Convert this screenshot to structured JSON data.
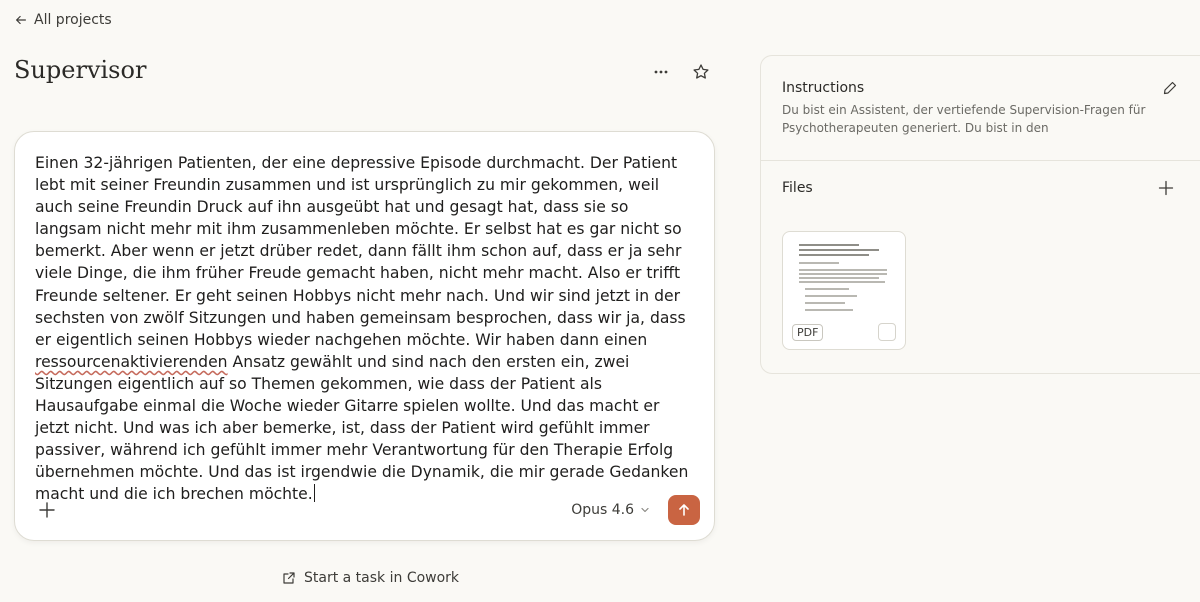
{
  "nav": {
    "back_label": "All projects"
  },
  "project": {
    "title": "Supervisor"
  },
  "composer": {
    "text_before": "Einen 32-jährigen Patienten, der eine depressive Episode durchmacht. Der Patient lebt mit seiner Freundin zusammen und ist ursprünglich zu mir gekommen, weil auch seine Freundin Druck auf ihn ausgeübt hat und gesagt hat, dass sie so langsam nicht mehr mit ihm zusammenleben möchte. Er selbst hat es gar nicht so bemerkt. Aber wenn er jetzt drüber redet, dann fällt ihm schon auf, dass er ja sehr viele Dinge, die ihm früher Freude gemacht haben, nicht mehr macht. Also er trifft Freunde seltener. Er geht seinen Hobbys nicht mehr nach. Und wir sind jetzt in der sechsten von zwölf Sitzungen und haben gemeinsam besprochen, dass wir ja, dass er eigentlich seinen Hobbys wieder nachgehen möchte. Wir haben dann einen",
    "text_flagged": "ressourcenaktivierenden",
    "text_after": "Ansatz gewählt und sind nach den ersten ein, zwei Sitzungen eigentlich auf so Themen gekommen, wie dass der Patient als Hausaufgabe einmal die Woche wieder Gitarre spielen wollte. Und das macht er jetzt nicht. Und was ich aber bemerke, ist, dass der Patient wird gefühlt immer passiver, während ich gefühlt immer mehr Verantwortung für den Therapie Erfolg übernehmen möchte. Und das ist irgendwie die Dynamik, die mir gerade Gedanken macht und die ich brechen möchte.",
    "model_label": "Opus 4.6",
    "send_color": "#c96442"
  },
  "cowork": {
    "label": "Start a task in Cowork"
  },
  "sidebar": {
    "instructions_title": "Instructions",
    "instructions_text": "Du bist ein Assistent, der vertiefende Supervision-Fragen für Psychotherapeuten generiert. Du bist in den Supervisionsprozess…",
    "files_title": "Files",
    "files": [
      {
        "type_badge": "PDF"
      }
    ]
  },
  "icons": {
    "back": "arrow-left-icon",
    "more": "ellipsis-icon",
    "star": "star-icon",
    "plus": "plus-icon",
    "chevron": "chevron-down-icon",
    "send": "arrow-up-icon",
    "external": "external-link-icon",
    "edit": "pencil-icon"
  }
}
